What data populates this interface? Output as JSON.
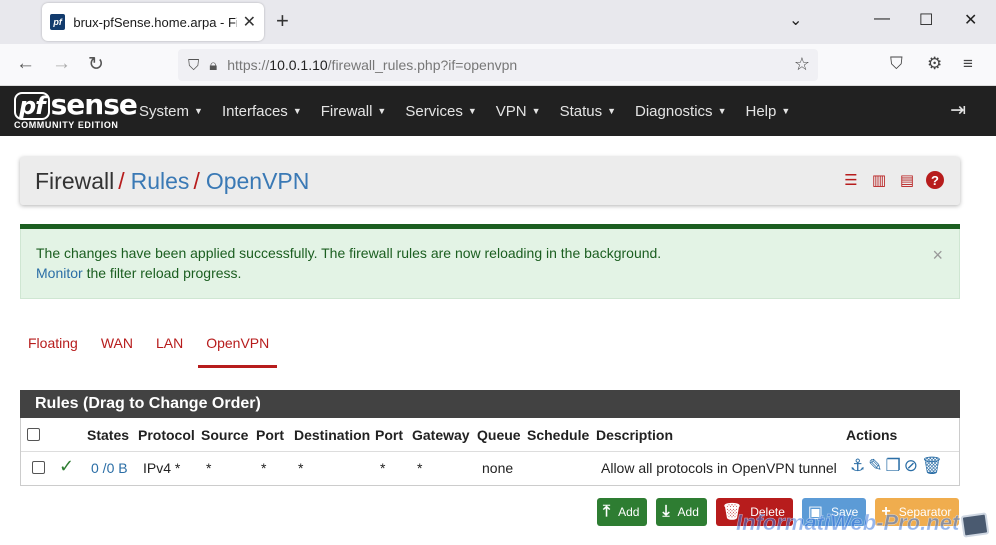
{
  "browser": {
    "tab_title": "brux-pfSense.home.arpa - Firewall",
    "favicon_text": "pf",
    "url_prefix": "https://",
    "url_host": "10.0.1.10",
    "url_path": "/firewall_rules.php?if=openvpn"
  },
  "logo": {
    "pf": "pf",
    "sense": "sense",
    "sub": "COMMUNITY EDITION"
  },
  "menu": [
    {
      "label": "System"
    },
    {
      "label": "Interfaces"
    },
    {
      "label": "Firewall"
    },
    {
      "label": "Services"
    },
    {
      "label": "VPN"
    },
    {
      "label": "Status"
    },
    {
      "label": "Diagnostics"
    },
    {
      "label": "Help"
    }
  ],
  "breadcrumb": {
    "part1": "Firewall",
    "part2": "Rules",
    "part3": "OpenVPN",
    "sep": "/"
  },
  "alert": {
    "line1": "The changes have been applied successfully. The firewall rules are now reloading in the background.",
    "link": "Monitor",
    "line2_rest": " the filter reload progress."
  },
  "interface_tabs": [
    {
      "label": "Floating"
    },
    {
      "label": "WAN"
    },
    {
      "label": "LAN"
    },
    {
      "label": "OpenVPN",
      "active": true
    }
  ],
  "rules": {
    "title": "Rules (Drag to Change Order)",
    "headers": {
      "states": "States",
      "protocol": "Protocol",
      "source": "Source",
      "port": "Port",
      "destination": "Destination",
      "port2": "Port",
      "gateway": "Gateway",
      "queue": "Queue",
      "schedule": "Schedule",
      "description": "Description",
      "actions": "Actions"
    },
    "row": {
      "states": "0 /0 B",
      "protocol": "IPv4 *",
      "source": "*",
      "port": "*",
      "destination": "*",
      "port2": "*",
      "gateway": "*",
      "queue": "none",
      "schedule": "",
      "description": "Allow all protocols in OpenVPN tunnel"
    }
  },
  "buttons": {
    "add_top": "Add",
    "add_bottom": "Add",
    "delete": "Delete",
    "save": "Save",
    "separator": "Separator"
  },
  "watermark": "InformatiWeb-Pro.net",
  "colors": {
    "brand_red": "#b71c1c",
    "header_dark": "#212121",
    "success_green": "#1b5e20",
    "link_blue": "#2b6ea6"
  }
}
